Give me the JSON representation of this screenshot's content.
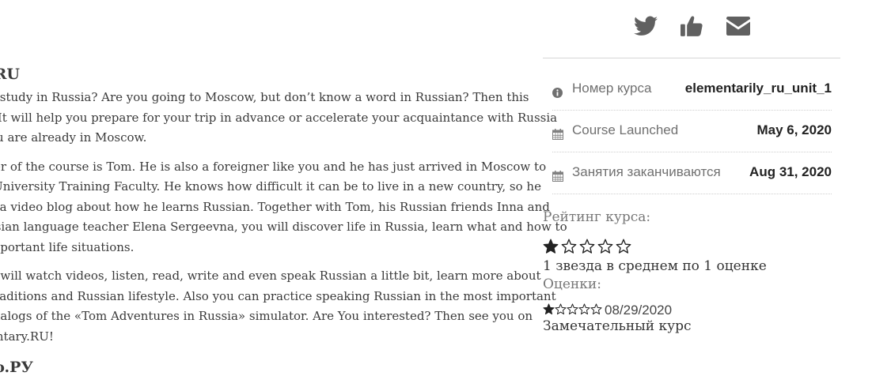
{
  "article": {
    "heading_top": ".RU",
    "paragraphs": [
      {
        "lines": [
          "o study in Russia? Are you going to Moscow, but don’t know a word in Russian? Then this",
          "! It will help you prepare for your trip in advance or accelerate your acquaintance with Russia",
          "ou are already in Moscow."
        ]
      },
      {
        "lines": [
          "ter of the course is Tom. He is also a foreigner like you and he has just arrived in Moscow to",
          "-University Training Faculty. He knows how difficult it can be to live in a new country, so he",
          "e a video blog about how he learns Russian. Together with Tom, his Russian friends Inna and",
          "ssian language teacher Elena Sergeevna, you will discover life in Russia, learn what and how to",
          "mportant life situations."
        ]
      },
      {
        "lines": [
          "u will watch videos, listen, read, write and even speak Russian a little bit, learn more about",
          "traditions and Russian lifestyle. Also you can practice speaking Russian in the most important",
          "dialogs of the «Tom Adventures in Russia» simulator. Are You interested? Then see you on",
          "entary.RU!"
        ]
      }
    ],
    "heading_bottom": "ıo.РУ"
  },
  "share": {
    "icons": [
      "twitter-icon",
      "thumbs-up-icon",
      "envelope-icon"
    ]
  },
  "facts": [
    {
      "icon": "info-icon",
      "label": "Номер курса",
      "value": "elementarily_ru_unit_1"
    },
    {
      "icon": "calendar-icon",
      "label": "Course Launched",
      "value": "May 6, 2020"
    },
    {
      "icon": "calendar-icon",
      "label": "Занятия заканчиваются",
      "value": "Aug 31, 2020"
    }
  ],
  "rating": {
    "title": "Рейтинг курса:",
    "stars_filled": 1,
    "stars_total": 5,
    "average_text": "1 звезда в среднем по 1 оценке",
    "reviews_title": "Оценки:"
  },
  "review": {
    "stars_filled": 1,
    "stars_total": 5,
    "date": "08/29/2020",
    "text": "Замечательный курс"
  },
  "colors": {
    "icon": "#606060",
    "star": "#222222",
    "divider": "#d6d6d6"
  }
}
